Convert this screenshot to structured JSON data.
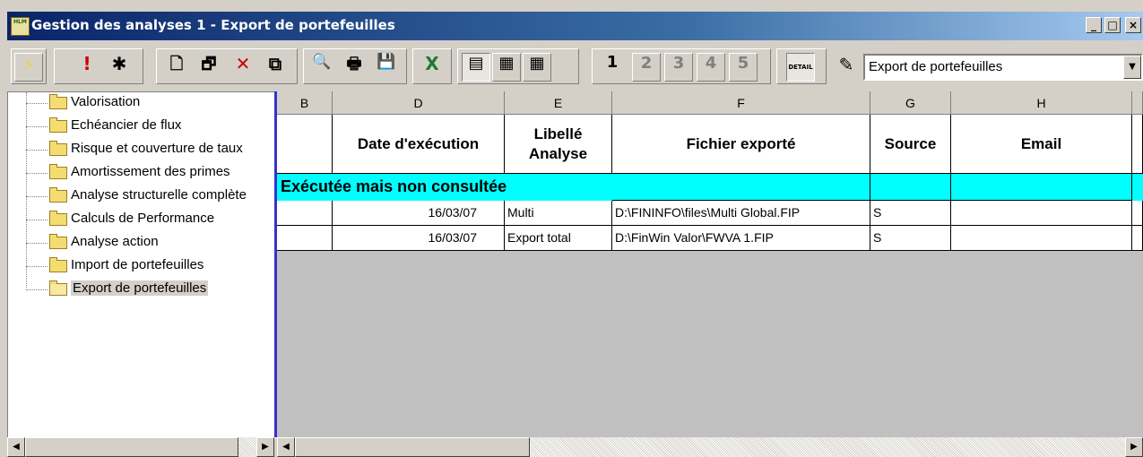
{
  "window": {
    "title": "Gestion des analyses 1  -  Export de portefeuilles",
    "icon_label": "HLM",
    "controls": {
      "minimize": "_",
      "maximize": "□",
      "close": "×"
    }
  },
  "toolbar": {
    "buttons": [
      {
        "name": "lightning-icon",
        "glyph": "⚡",
        "disabled": true
      },
      {
        "name": "exclamation-icon",
        "glyph": "!"
      },
      {
        "name": "stop-icon",
        "glyph": "✱"
      },
      {
        "name": "new-document-icon",
        "glyph": "🗋"
      },
      {
        "name": "properties-icon",
        "glyph": "🗗"
      },
      {
        "name": "delete-icon",
        "glyph": "✕"
      },
      {
        "name": "copy-icon",
        "glyph": "⧉"
      },
      {
        "name": "print-preview-icon",
        "glyph": "🔍"
      },
      {
        "name": "print-icon",
        "glyph": "🖶"
      },
      {
        "name": "save-icon",
        "glyph": "💾"
      },
      {
        "name": "excel-icon",
        "glyph": "X"
      },
      {
        "name": "view-tree-icon",
        "glyph": "▤"
      },
      {
        "name": "view-list-icon",
        "glyph": "▦"
      },
      {
        "name": "view-grid-icon",
        "glyph": "▦"
      }
    ],
    "level_buttons": [
      "1",
      "2",
      "3",
      "4",
      "5"
    ],
    "detail_label": "DETAIL",
    "edit_icon": "✎",
    "combo_value": "Export de portefeuilles"
  },
  "tree": {
    "items": [
      {
        "label": "Valorisation"
      },
      {
        "label": "Echéancier de flux"
      },
      {
        "label": "Risque et couverture de taux"
      },
      {
        "label": "Amortissement des primes"
      },
      {
        "label": "Analyse structurelle complète"
      },
      {
        "label": "Calculs de Performance"
      },
      {
        "label": "Analyse action"
      },
      {
        "label": "Import de portefeuilles"
      },
      {
        "label": "Export de portefeuilles",
        "selected": true
      }
    ]
  },
  "grid": {
    "column_letters": [
      "B",
      "D",
      "E",
      "F",
      "G",
      "H",
      ""
    ],
    "headers": {
      "date": "Date d'exécution",
      "libelle": "Libellé Analyse",
      "fichier": "Fichier exporté",
      "source": "Source",
      "email": "Email"
    },
    "group_label": "Exécutée mais non consultée",
    "rows": [
      {
        "date": "16/03/07",
        "libelle": "Multi",
        "fichier": "D:\\FININFO\\files\\Multi Global.FIP",
        "source": "S",
        "email": ""
      },
      {
        "date": "16/03/07",
        "libelle": "Export total",
        "fichier": "D:\\FinWin Valor\\FWVA 1.FIP",
        "source": "S",
        "email": ""
      }
    ],
    "group_color": "#00ffff"
  },
  "scrollbars": {
    "left": "◀",
    "right": "▶"
  }
}
